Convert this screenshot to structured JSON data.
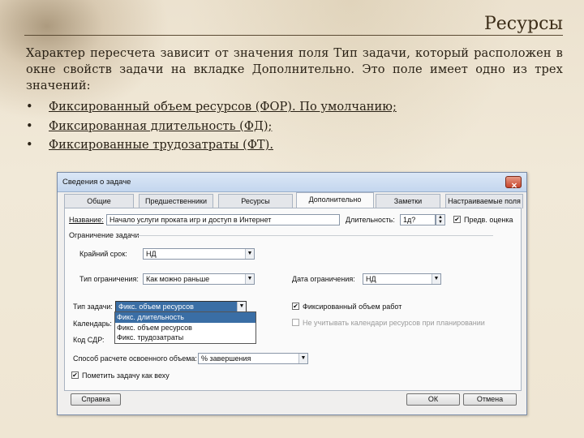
{
  "slide": {
    "title": "Ресурсы",
    "paragraph": "Характер пересчета зависит от значения поля Тип задачи, который расположен в окне свойств задачи на вкладке Дополнительно. Это поле имеет одно из трех значений:",
    "bullets": [
      "Фиксированный объем ресурсов (ФОР). По умолчанию;",
      "Фиксированная длительность (ФД);",
      "Фиксированные трудозатраты (ФТ)."
    ]
  },
  "dialog": {
    "title": "Сведения о задаче",
    "close_glyph": "✕",
    "tabs": [
      "Общие",
      "Предшественники",
      "Ресурсы",
      "Дополнительно",
      "Заметки",
      "Настраиваемые поля"
    ],
    "active_tab": "Дополнительно",
    "name_label": "Название:",
    "name_value": "Начало услуги проката игр и доступ в Интернет",
    "duration_label": "Длительность:",
    "duration_value": "1д?",
    "estimate_label": "Предв. оценка",
    "estimate_checked": true,
    "constraint_group_label": "Ограничение задачи",
    "deadline_label": "Крайний срок:",
    "deadline_value": "НД",
    "constraint_type_label": "Тип ограничения:",
    "constraint_type_value": "Как можно раньше",
    "constraint_date_label": "Дата ограничения:",
    "constraint_date_value": "НД",
    "task_type_label": "Тип задачи:",
    "task_type_value": "Фикс. объем ресурсов",
    "task_type_options": [
      "Фикс. длительность",
      "Фикс. объем ресурсов",
      "Фикс. трудозатраты"
    ],
    "effort_driven_label": "Фиксированный объем работ",
    "effort_driven_checked": true,
    "calendar_label": "Календарь:",
    "ignore_calendar_label": "Не учитывать календари ресурсов при планировании",
    "wbs_label": "Код СДР:",
    "earned_value_label": "Способ расчете освоенного объема:",
    "earned_value_value": "% завершения",
    "milestone_label": "Пометить задачу как веху",
    "milestone_checked": true,
    "help_button": "Справка",
    "ok_button": "ОК",
    "cancel_button": "Отмена",
    "checkmark": "✔",
    "dropdown_arrow": "▼",
    "spin_up": "▲",
    "spin_down": "▼"
  },
  "colors": {
    "title_bar": "#c4d6ee",
    "selection": "#3a6ea5",
    "close_button": "#c8452c"
  }
}
